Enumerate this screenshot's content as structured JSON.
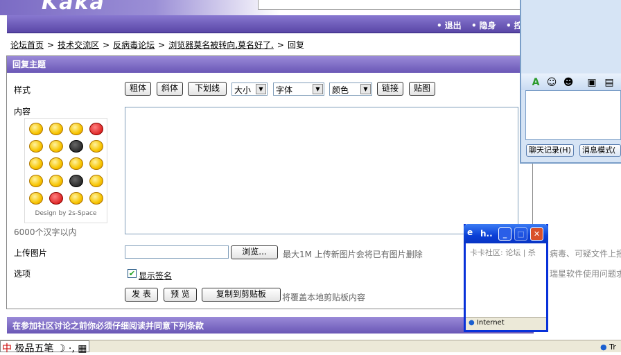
{
  "banner": {
    "logo": "Kaka"
  },
  "nav": [
    {
      "label": "退出"
    },
    {
      "label": "隐身"
    },
    {
      "label": "控"
    }
  ],
  "breadcrumb": {
    "items": [
      "论坛首页",
      "技术交流区",
      "反病毒论坛",
      "浏览器莫名被转向,莫名好了.",
      "回复"
    ],
    "separator": ">"
  },
  "form": {
    "title": "回复主题",
    "style_label": "样式",
    "content_label": "内容",
    "format_buttons": [
      "粗体",
      "斜体",
      "下划线"
    ],
    "size_select": "大小",
    "font_select": "字体",
    "color_select": "颜色",
    "link_button": "链接",
    "image_button": "贴图",
    "emoji_credit": "Design by 2s-Space",
    "char_limit": "6000个汉字以内",
    "upload_label": "上传图片",
    "browse_button": "浏览...",
    "upload_hint": "最大1M 上传新图片会将已有图片删除",
    "options_label": "选项",
    "show_signature_label": "显示签名",
    "show_signature_checked": true,
    "submit_button": "发 表",
    "preview_button": "预 览",
    "copy_button": "复制到剪贴板",
    "copy_hint": "将覆盖本地剪贴板内容"
  },
  "terms": {
    "title": "在参加社区讨论之前你必须仔细阅读并同意下列条款"
  },
  "chat": {
    "history_button": "聊天记录(H)",
    "message_mode_button": "消息模式(",
    "right_text_1": "病毒、可疑文件上报",
    "right_text_2": "瑞星软件使用问题求"
  },
  "popup": {
    "title": "h..",
    "body_text": "卡卡社区: 论坛 | 杀",
    "status": "Internet"
  },
  "taskbar": {
    "ime_text": "极品五笔",
    "tray_text": "Tr"
  },
  "colors": {
    "header_purple": "#6a57b6",
    "popup_blue": "#0a3fd6"
  }
}
